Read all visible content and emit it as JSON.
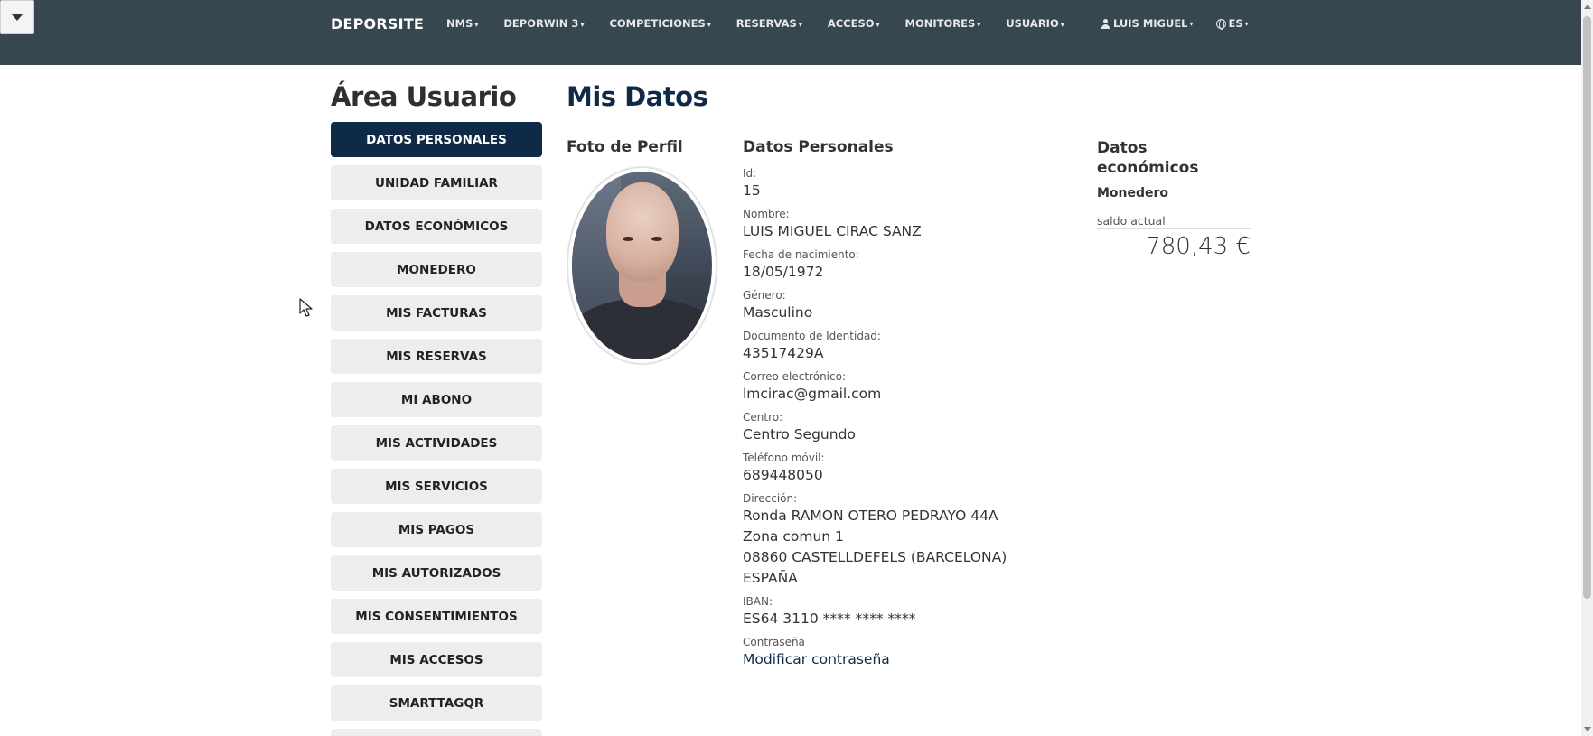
{
  "navbar": {
    "brand": "DEPORSITE",
    "items": [
      {
        "label": "NMS"
      },
      {
        "label": "DEPORWIN 3"
      },
      {
        "label": "COMPETICIONES"
      },
      {
        "label": "RESERVAS"
      },
      {
        "label": "ACCESO"
      },
      {
        "label": "MONITORES"
      },
      {
        "label": "USUARIO"
      }
    ],
    "user_label": "LUIS MIGUEL",
    "language_label": "ES",
    "dropdown_caret": "▾"
  },
  "sidebar": {
    "title": "Área Usuario",
    "items": [
      {
        "label": "DATOS PERSONALES",
        "active": true
      },
      {
        "label": "UNIDAD FAMILIAR"
      },
      {
        "label": "DATOS ECONÓMICOS"
      },
      {
        "label": "MONEDERO"
      },
      {
        "label": "MIS FACTURAS"
      },
      {
        "label": "MIS RESERVAS"
      },
      {
        "label": "MI ABONO"
      },
      {
        "label": "MIS ACTIVIDADES"
      },
      {
        "label": "MIS SERVICIOS"
      },
      {
        "label": "MIS PAGOS"
      },
      {
        "label": "MIS AUTORIZADOS"
      },
      {
        "label": "MIS CONSENTIMIENTOS"
      },
      {
        "label": "MIS ACCESOS"
      },
      {
        "label": "SMARTTAGQR"
      }
    ]
  },
  "main": {
    "title": "Mis Datos",
    "photo_title": "Foto de Perfil",
    "personal": {
      "title": "Datos Personales",
      "id_label": "Id:",
      "id_value": "15",
      "name_label": "Nombre:",
      "name_value": "LUIS MIGUEL CIRAC SANZ",
      "birth_label": "Fecha de nacimiento:",
      "birth_value": "18/05/1972",
      "gender_label": "Género:",
      "gender_value": "Masculino",
      "doc_label": "Documento de Identidad:",
      "doc_value": "43517429A",
      "email_label": "Correo electrónico:",
      "email_value": "lmcirac@gmail.com",
      "center_label": "Centro:",
      "center_value": "Centro Segundo",
      "phone_label": "Teléfono móvil:",
      "phone_value": "689448050",
      "address_label": "Dirección:",
      "address_lines": [
        "Ronda RAMON OTERO PEDRAYO 44A",
        "Zona comun 1",
        "08860 CASTELLDEFELS (BARCELONA)",
        "ESPAÑA"
      ],
      "iban_label": "IBAN:",
      "iban_value": "ES64 3110 **** **** ****",
      "password_label": "Contraseña",
      "password_link": "Modificar contraseña"
    },
    "economic": {
      "title": "Datos económicos",
      "monedero_title": "Monedero",
      "saldo_label": "saldo actual",
      "saldo_value": "780,43 €"
    }
  },
  "colors": {
    "navbar_bg": "#37474f",
    "active_menu": "#0e2a47",
    "menu_bg": "#ededed"
  }
}
